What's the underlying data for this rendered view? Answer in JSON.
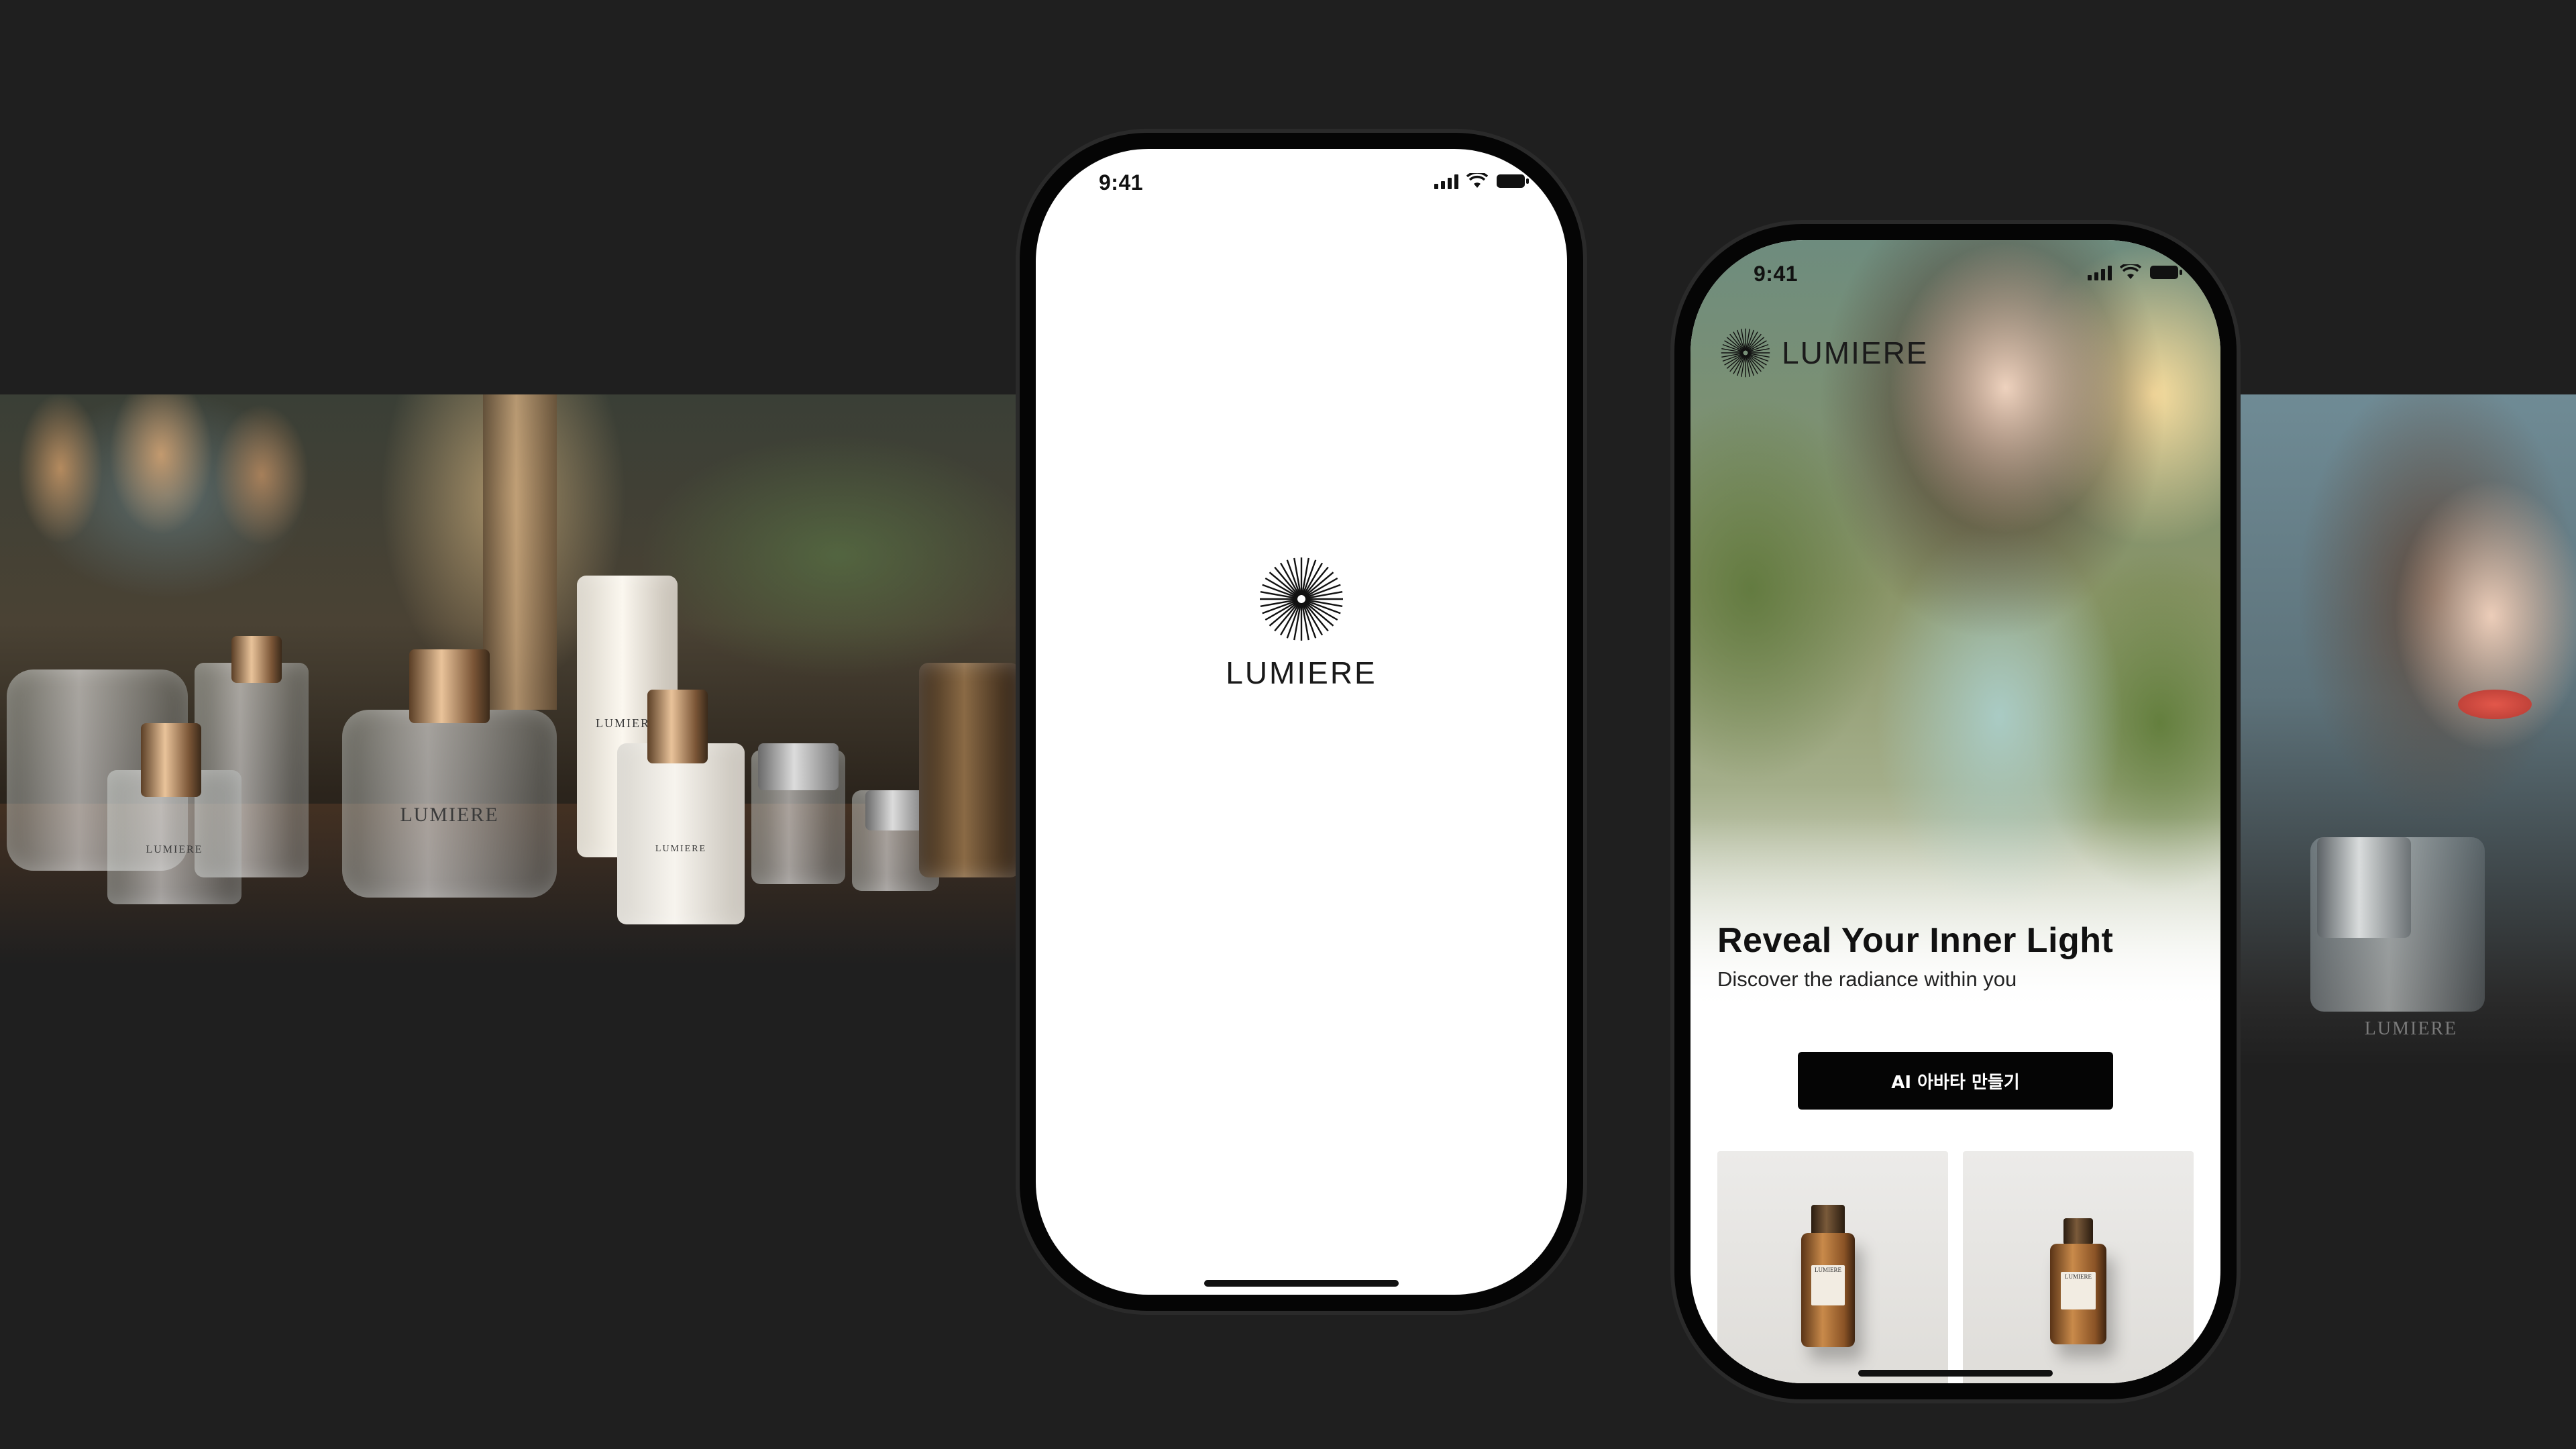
{
  "background_color": "#1f1f1f",
  "left_banner": {
    "bottle_labels": [
      "LUMIERE",
      "LUMIERE",
      "LUMIERE",
      "LUMIERE"
    ]
  },
  "right_banner": {
    "bottle_label": "LUMIERE"
  },
  "splash_screen": {
    "status_time": "9:41",
    "logo_icon": "sunburst-icon",
    "brand": "LUMIERE"
  },
  "home_screen": {
    "status_time": "9:41",
    "logo_icon": "sunburst-icon",
    "brand": "LUMIERE",
    "hero_title": "Reveal Your Inner Light",
    "hero_subtitle": "Discover the radiance within you",
    "cta_label": "AI 아바타 만들기",
    "products": [
      {
        "label": "LUMIERE"
      },
      {
        "label": "LUMIERE"
      }
    ]
  }
}
